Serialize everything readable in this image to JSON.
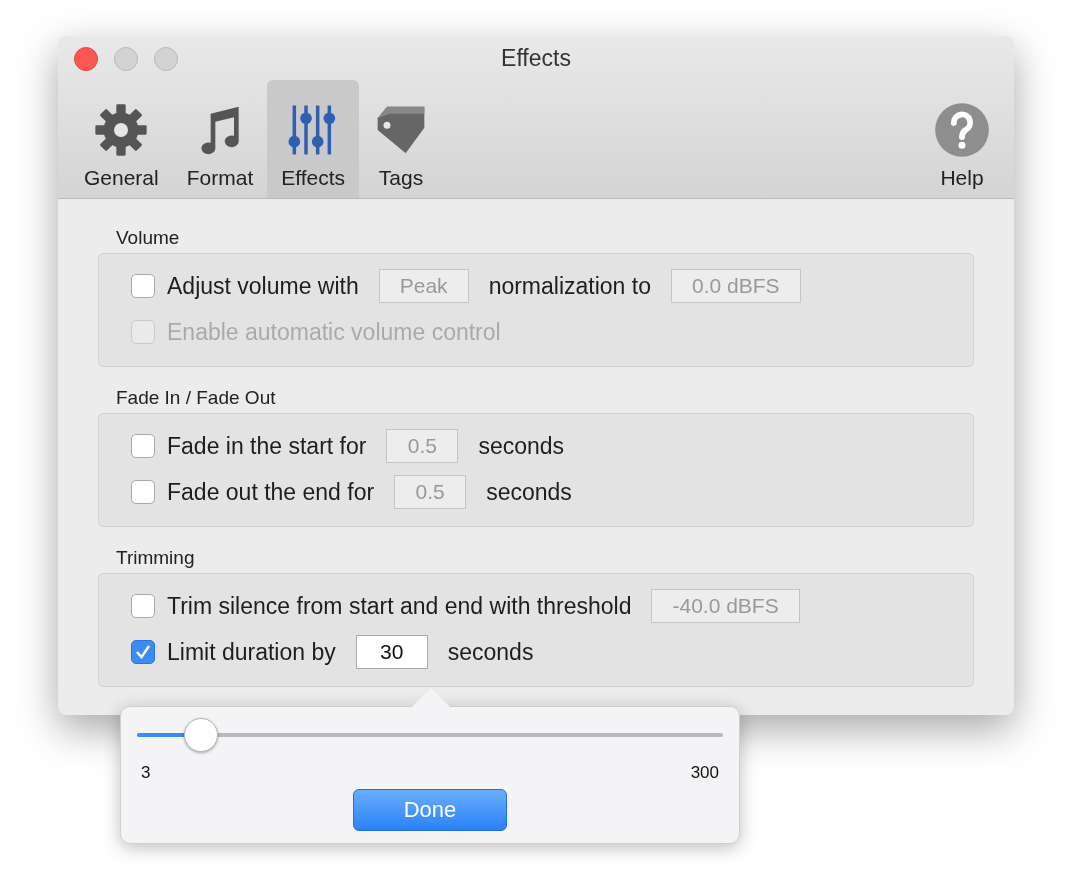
{
  "window": {
    "title": "Effects"
  },
  "toolbar": {
    "items": [
      {
        "kind": "gear",
        "label": "General",
        "selected": false
      },
      {
        "kind": "note",
        "label": "Format",
        "selected": false
      },
      {
        "kind": "sliders",
        "label": "Effects",
        "selected": true
      },
      {
        "kind": "tag",
        "label": "Tags",
        "selected": false
      }
    ],
    "help": {
      "label": "Help"
    }
  },
  "sections": [
    {
      "title": "Volume",
      "rows": [
        {
          "checked": false,
          "disabled": false,
          "parts": [
            {
              "kind": "text",
              "text": "Adjust volume with"
            },
            {
              "kind": "field",
              "text": "Peak",
              "disabled": true
            },
            {
              "kind": "text",
              "text": "normalization to"
            },
            {
              "kind": "field",
              "text": "0.0 dBFS",
              "disabled": true
            }
          ]
        },
        {
          "checked": false,
          "disabled": true,
          "parts": [
            {
              "kind": "text",
              "text": "Enable automatic volume control"
            }
          ]
        }
      ]
    },
    {
      "title": "Fade In / Fade Out",
      "rows": [
        {
          "checked": false,
          "disabled": false,
          "parts": [
            {
              "kind": "text",
              "text": "Fade in the start for"
            },
            {
              "kind": "field",
              "text": "0.5",
              "disabled": true
            },
            {
              "kind": "text",
              "text": "seconds"
            }
          ]
        },
        {
          "checked": false,
          "disabled": false,
          "parts": [
            {
              "kind": "text",
              "text": "Fade out the end for"
            },
            {
              "kind": "field",
              "text": "0.5",
              "disabled": true
            },
            {
              "kind": "text",
              "text": "seconds"
            }
          ]
        }
      ]
    },
    {
      "title": "Trimming",
      "rows": [
        {
          "checked": false,
          "disabled": false,
          "parts": [
            {
              "kind": "text",
              "text": "Trim silence from start and end with threshold"
            },
            {
              "kind": "field",
              "text": "-40.0 dBFS",
              "disabled": true
            }
          ]
        },
        {
          "checked": true,
          "disabled": false,
          "parts": [
            {
              "kind": "text",
              "text": "Limit duration by"
            },
            {
              "kind": "field",
              "text": "30",
              "disabled": false
            },
            {
              "kind": "text",
              "text": "seconds"
            }
          ]
        }
      ]
    }
  ],
  "popover": {
    "level": 0.11,
    "min_label": "3",
    "max_label": "300",
    "button": "Done"
  }
}
